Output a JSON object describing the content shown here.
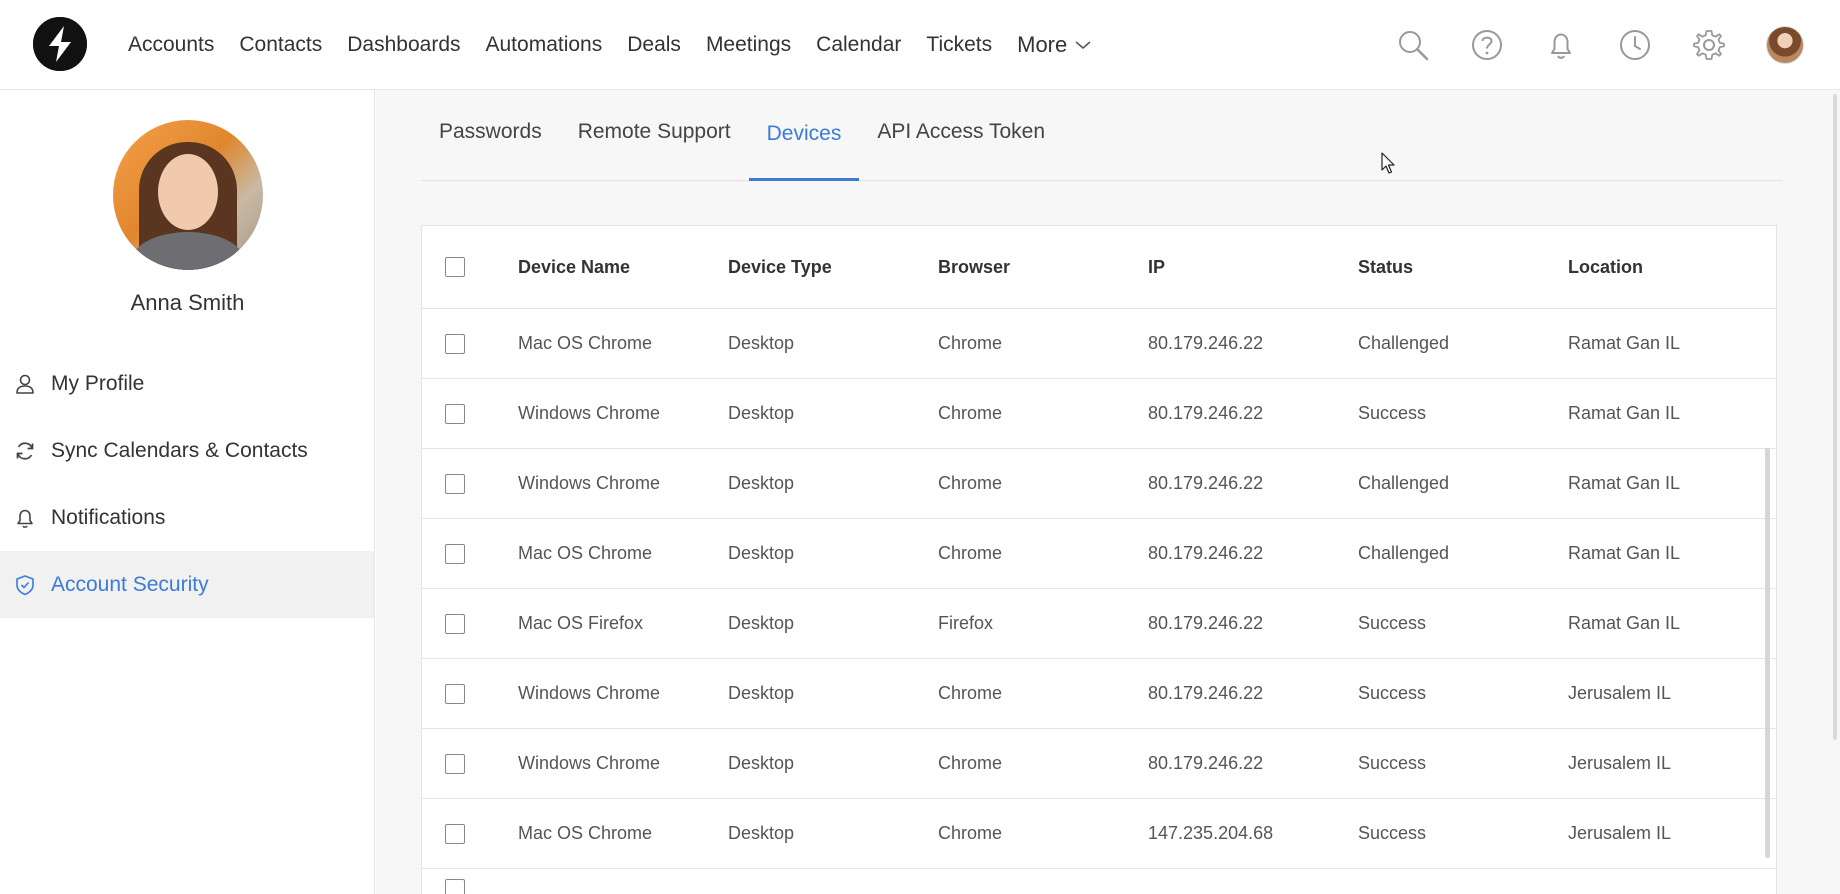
{
  "nav": {
    "items": [
      "Accounts",
      "Contacts",
      "Dashboards",
      "Automations",
      "Deals",
      "Meetings",
      "Calendar",
      "Tickets"
    ],
    "more_label": "More"
  },
  "top_icons": [
    "search-icon",
    "help-icon",
    "bell-icon",
    "clock-icon",
    "gear-icon",
    "user-avatar"
  ],
  "user": {
    "name": "Anna Smith"
  },
  "sidebar": {
    "items": [
      {
        "label": "My Profile",
        "icon": "person-icon"
      },
      {
        "label": "Sync Calendars & Contacts",
        "icon": "sync-icon"
      },
      {
        "label": "Notifications",
        "icon": "bell-icon"
      },
      {
        "label": "Account Security",
        "icon": "shield-icon",
        "active": true
      }
    ]
  },
  "tabs": [
    {
      "label": "Passwords"
    },
    {
      "label": "Remote Support"
    },
    {
      "label": "Devices",
      "active": true
    },
    {
      "label": "API Access Token"
    }
  ],
  "table": {
    "headers": [
      "Device Name",
      "Device Type",
      "Browser",
      "IP",
      "Status",
      "Location"
    ],
    "rows": [
      [
        "Mac OS Chrome",
        "Desktop",
        "Chrome",
        "80.179.246.22",
        "Challenged",
        "Ramat Gan IL"
      ],
      [
        "Windows Chrome",
        "Desktop",
        "Chrome",
        "80.179.246.22",
        "Success",
        "Ramat Gan IL"
      ],
      [
        "Windows Chrome",
        "Desktop",
        "Chrome",
        "80.179.246.22",
        "Challenged",
        "Ramat Gan IL"
      ],
      [
        "Mac OS Chrome",
        "Desktop",
        "Chrome",
        "80.179.246.22",
        "Challenged",
        "Ramat Gan IL"
      ],
      [
        "Mac OS Firefox",
        "Desktop",
        "Firefox",
        "80.179.246.22",
        "Success",
        "Ramat Gan IL"
      ],
      [
        "Windows Chrome",
        "Desktop",
        "Chrome",
        "80.179.246.22",
        "Success",
        "Jerusalem IL"
      ],
      [
        "Windows Chrome",
        "Desktop",
        "Chrome",
        "80.179.246.22",
        "Success",
        "Jerusalem IL"
      ],
      [
        "Mac OS Chrome",
        "Desktop",
        "Chrome",
        "147.235.204.68",
        "Success",
        "Jerusalem IL"
      ]
    ]
  },
  "colors": {
    "accent": "#3b7bd6",
    "active_bg": "#f1f1f1",
    "main_bg": "#f7f7f7"
  }
}
